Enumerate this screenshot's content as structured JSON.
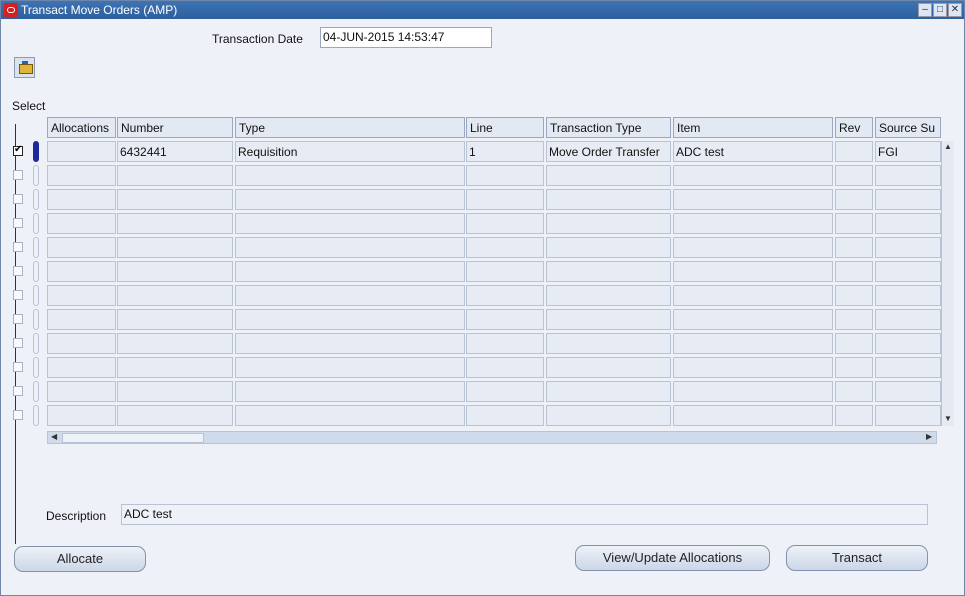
{
  "window": {
    "title": "Transact Move Orders (AMP)"
  },
  "header": {
    "transaction_date_label": "Transaction Date",
    "transaction_date_value": "04-JUN-2015 14:53:47"
  },
  "grid": {
    "select_label": "Select",
    "columns": [
      "Allocations",
      "Number",
      "Type",
      "Line",
      "Transaction Type",
      "Item",
      "Rev",
      "Source Su"
    ],
    "rows": [
      {
        "checked": true,
        "cells": [
          "",
          "6432441",
          "Requisition",
          "1",
          "Move Order Transfer",
          "ADC test",
          "",
          "FGI"
        ]
      },
      {
        "checked": false,
        "cells": [
          "",
          "",
          "",
          "",
          "",
          "",
          "",
          ""
        ]
      },
      {
        "checked": false,
        "cells": [
          "",
          "",
          "",
          "",
          "",
          "",
          "",
          ""
        ]
      },
      {
        "checked": false,
        "cells": [
          "",
          "",
          "",
          "",
          "",
          "",
          "",
          ""
        ]
      },
      {
        "checked": false,
        "cells": [
          "",
          "",
          "",
          "",
          "",
          "",
          "",
          ""
        ]
      },
      {
        "checked": false,
        "cells": [
          "",
          "",
          "",
          "",
          "",
          "",
          "",
          ""
        ]
      },
      {
        "checked": false,
        "cells": [
          "",
          "",
          "",
          "",
          "",
          "",
          "",
          ""
        ]
      },
      {
        "checked": false,
        "cells": [
          "",
          "",
          "",
          "",
          "",
          "",
          "",
          ""
        ]
      },
      {
        "checked": false,
        "cells": [
          "",
          "",
          "",
          "",
          "",
          "",
          "",
          ""
        ]
      },
      {
        "checked": false,
        "cells": [
          "",
          "",
          "",
          "",
          "",
          "",
          "",
          ""
        ]
      },
      {
        "checked": false,
        "cells": [
          "",
          "",
          "",
          "",
          "",
          "",
          "",
          ""
        ]
      },
      {
        "checked": false,
        "cells": [
          "",
          "",
          "",
          "",
          "",
          "",
          "",
          ""
        ]
      }
    ]
  },
  "description": {
    "label": "Description",
    "value": "ADC test"
  },
  "buttons": {
    "allocate": "Allocate",
    "view_update": "View/Update Allocations",
    "transact": "Transact"
  }
}
